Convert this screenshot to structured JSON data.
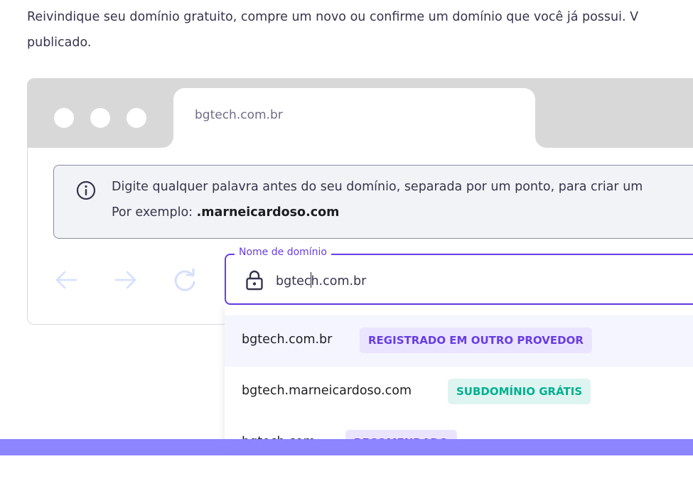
{
  "intro": {
    "line1": "Reivindique seu domínio gratuito, compre um novo ou confirme um domínio que você já possui. V",
    "line2": "publicado."
  },
  "browser": {
    "tab_title": "bgtech.com.br",
    "info": {
      "line1": "Digite qualquer palavra antes do seu domínio, separada por um ponto, para criar um",
      "line2_prefix": "Por exemplo: ",
      "line2_example": ".marneicardoso.com"
    },
    "nav": {
      "back_icon": "arrow-left-icon",
      "forward_icon": "arrow-right-icon",
      "reload_icon": "reload-icon"
    },
    "domain_field": {
      "label": "Nome de domínio",
      "value_before_caret": "bgtec",
      "value_after_caret": "h.com.br",
      "icon": "lock-icon"
    },
    "suggestions": [
      {
        "domain": "bgtech.com.br",
        "badge": "REGISTRADO EM OUTRO PROVEDOR",
        "badge_color": "#673de6"
      },
      {
        "domain": "bgtech.marneicardoso.com",
        "badge": "SUBDOMÍNIO GRÁTIS",
        "badge_color": "#00b090"
      },
      {
        "domain": "bgtech.com",
        "badge": "RECOMENDADO"
      }
    ]
  },
  "colors": {
    "accent": "#673de6",
    "success": "#00b090",
    "band": "#8c85ff"
  }
}
